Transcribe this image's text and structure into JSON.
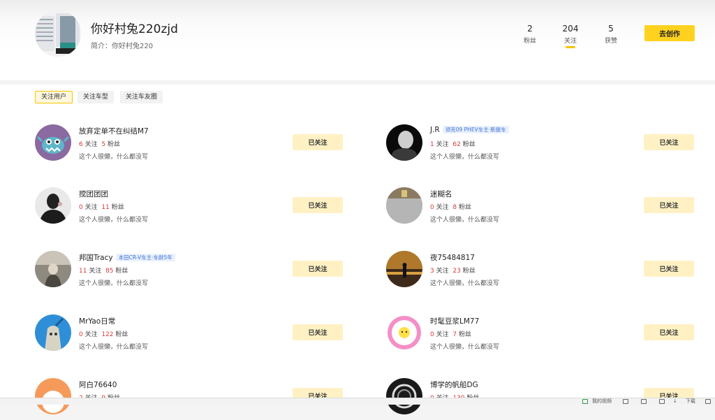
{
  "profile": {
    "username": "你好村兔220zjd",
    "bio": "简介：你好村兔220",
    "stats": [
      {
        "num": "2",
        "label": "粉丝"
      },
      {
        "num": "204",
        "label": "关注"
      },
      {
        "num": "5",
        "label": "获赞"
      }
    ],
    "create_label": "去创作"
  },
  "tabs": [
    "关注用户",
    "关注车型",
    "关注车友圈"
  ],
  "follow_label": "已关注",
  "users": [
    {
      "name": "放弃定单不在纠结M7",
      "badge": "",
      "following": "6",
      "fans": "5",
      "desc": "这个人很懒，什么都没写"
    },
    {
      "name": "J.R",
      "badge": "领克09 PHEV车主·新提车",
      "following": "1",
      "fans": "62",
      "desc": "这个人很懒，什么都没写"
    },
    {
      "name": "搅团团团",
      "badge": "",
      "following": "0",
      "fans": "11",
      "desc": "这个人很懒，什么都没写"
    },
    {
      "name": "迷糊名",
      "badge": "",
      "following": "0",
      "fans": "8",
      "desc": "这个人很懒，什么都没写"
    },
    {
      "name": "邦国Tracy",
      "badge": "本田CR-V车主·车龄5年",
      "following": "11",
      "fans": "85",
      "desc": "这个人很懒，什么都没写"
    },
    {
      "name": "夜75484817",
      "badge": "",
      "following": "3",
      "fans": "23",
      "desc": "这个人很懒，什么都没写"
    },
    {
      "name": "MrYao日常",
      "badge": "",
      "following": "0",
      "fans": "122",
      "desc": "这个人很懒，什么都没写"
    },
    {
      "name": "时髦豆浆LM77",
      "badge": "",
      "following": "0",
      "fans": "7",
      "desc": "这个人很懒，什么都没写"
    },
    {
      "name": "阿白76640",
      "badge": "",
      "following": "2",
      "fans": "9",
      "desc": ""
    },
    {
      "name": "博学的帆船DG",
      "badge": "",
      "following": "0",
      "fans": "130",
      "desc": ""
    }
  ],
  "labels": {
    "following": "关注",
    "fans": "粉丝"
  },
  "bottom_bar": {
    "video": "我的视频",
    "download": "下载"
  }
}
